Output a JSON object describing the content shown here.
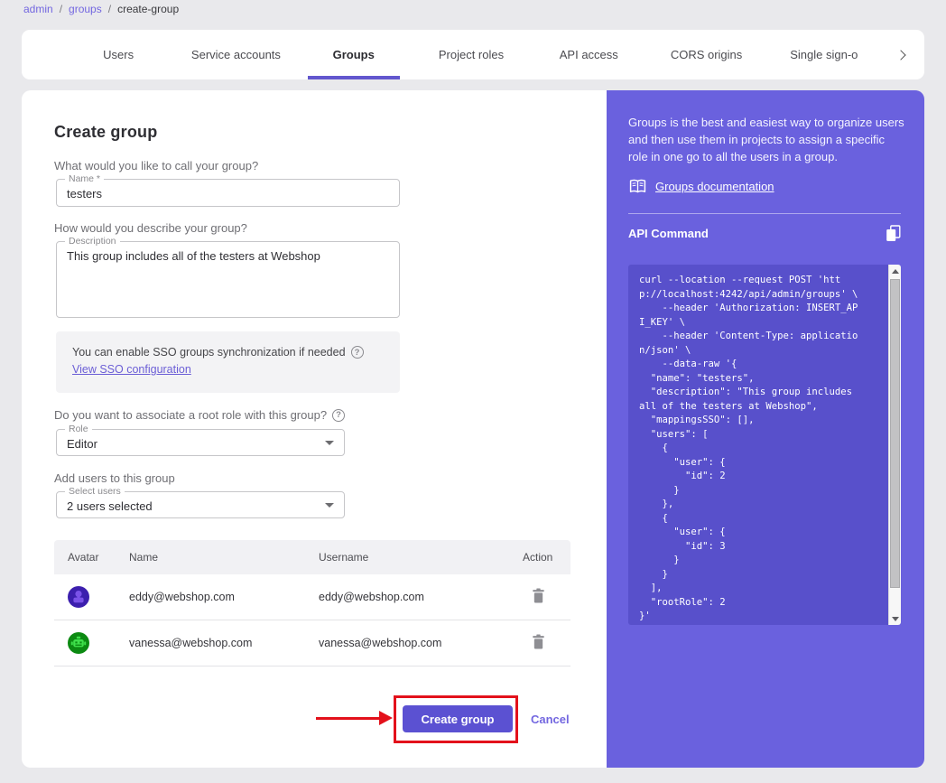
{
  "colors": {
    "accent_purple": "#6257ce",
    "sidebar_purple": "#6a61de",
    "code_background": "#5850cb",
    "button_purple": "#5b51d2",
    "link_purple": "#7367e0",
    "annotation_red": "#e3111b",
    "avatar_eddy_bg": "#3c1fae",
    "avatar_eddy_fg": "#7a52e8",
    "avatar_vanessa_bg": "#0c8a12",
    "avatar_vanessa_fg": "#3fe04b"
  },
  "breadcrumb": {
    "separator": "/",
    "items": [
      "admin",
      "groups",
      "create-group"
    ]
  },
  "tabs": {
    "items": [
      "Users",
      "Service accounts",
      "Groups",
      "Project roles",
      "API access",
      "CORS origins",
      "Single sign-o"
    ],
    "active": "Groups"
  },
  "form": {
    "title": "Create group",
    "name_question": "What would you like to call your group?",
    "name_label": "Name *",
    "name_value": "testers",
    "description_question": "How would you describe your group?",
    "description_label": "Description",
    "description_value": "This group includes all of the testers at Webshop",
    "sso_note": "You can enable SSO groups synchronization if needed",
    "sso_link_label": "View SSO configuration",
    "role_question": "Do you want to associate a root role with this group?",
    "role_label": "Role",
    "role_value": "Editor",
    "users_question": "Add users to this group",
    "users_label": "Select users",
    "users_value": "2 users selected"
  },
  "table": {
    "headers": [
      "Avatar",
      "Name",
      "Username",
      "Action"
    ],
    "rows": [
      {
        "name": "eddy@webshop.com",
        "username": "eddy@webshop.com"
      },
      {
        "name": "vanessa@webshop.com",
        "username": "vanessa@webshop.com"
      }
    ]
  },
  "actions": {
    "submit_label": "Create group",
    "cancel_label": "Cancel"
  },
  "sidebar": {
    "intro": "Groups is the best and easiest way to organize users and then use them in projects to assign a specific role in one go to all the users in a group.",
    "doc_link_label": "Groups documentation",
    "api_title": "API Command",
    "api_code": "curl --location --request POST 'htt\np://localhost:4242/api/admin/groups' \\\n    --header 'Authorization: INSERT_AP\nI_KEY' \\\n    --header 'Content-Type: applicatio\nn/json' \\\n    --data-raw '{\n  \"name\": \"testers\",\n  \"description\": \"This group includes\nall of the testers at Webshop\",\n  \"mappingsSSO\": [],\n  \"users\": [\n    {\n      \"user\": {\n        \"id\": 2\n      }\n    },\n    {\n      \"user\": {\n        \"id\": 3\n      }\n    }\n  ],\n  \"rootRole\": 2\n}'"
  },
  "icons": {
    "help_glyph": "?"
  }
}
